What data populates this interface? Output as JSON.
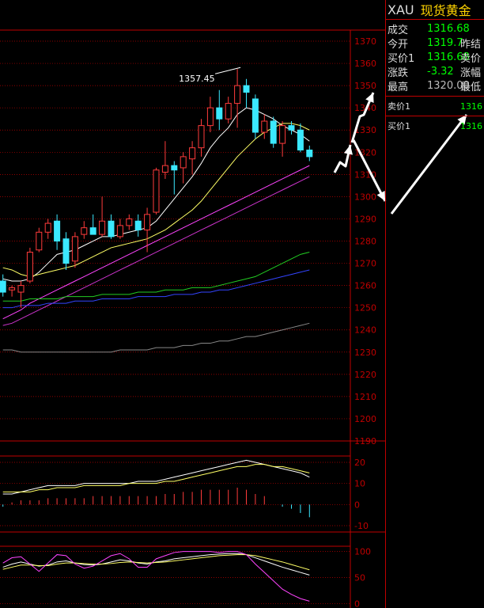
{
  "quote": {
    "symbol": "XAU",
    "name": "现货黄金",
    "rows": [
      {
        "label": "成交",
        "value": "1316.68",
        "color": "#00ff00",
        "label2": ""
      },
      {
        "label": "今开",
        "value": "1319.7",
        "color": "#00ff00",
        "label2": "昨结"
      },
      {
        "label": "买价1",
        "value": "1316.68",
        "color": "#00ff00",
        "label2": "卖价"
      },
      {
        "label": "涨跌",
        "value": "-3.32",
        "color": "#00ff00",
        "label2": "涨幅"
      },
      {
        "label": "最高",
        "value": "1320.00",
        "color": "#bbbbbb",
        "label2": "最低"
      }
    ],
    "sell1": {
      "label": "卖价1",
      "value": "1316"
    },
    "buy1": {
      "label": "买价1",
      "value": "1316"
    }
  },
  "chart_data": [
    {
      "type": "candlestick",
      "title": "",
      "ylim": [
        1190,
        1375
      ],
      "yticks": [
        "1370",
        "1360",
        "1350",
        "1340",
        "1330",
        "1320",
        "1310",
        "1300",
        "1290",
        "1280",
        "1270",
        "1260",
        "1250",
        "1240",
        "1230",
        "1220",
        "1210",
        "1200",
        "1190"
      ],
      "annotation": {
        "text": "1357.45",
        "value": 1357.45
      },
      "candles": [
        {
          "o": 1262,
          "h": 1265,
          "l": 1255,
          "c": 1257
        },
        {
          "o": 1258,
          "h": 1260,
          "l": 1255,
          "c": 1259
        },
        {
          "o": 1257,
          "h": 1262,
          "l": 1250,
          "c": 1260
        },
        {
          "o": 1262,
          "h": 1277,
          "l": 1261,
          "c": 1275
        },
        {
          "o": 1276,
          "h": 1286,
          "l": 1275,
          "c": 1284
        },
        {
          "o": 1284,
          "h": 1290,
          "l": 1281,
          "c": 1288
        },
        {
          "o": 1289,
          "h": 1292,
          "l": 1276,
          "c": 1280
        },
        {
          "o": 1281,
          "h": 1284,
          "l": 1267,
          "c": 1270
        },
        {
          "o": 1271,
          "h": 1284,
          "l": 1268,
          "c": 1282
        },
        {
          "o": 1283,
          "h": 1289,
          "l": 1281,
          "c": 1286
        },
        {
          "o": 1286,
          "h": 1292,
          "l": 1283,
          "c": 1283
        },
        {
          "o": 1283,
          "h": 1300,
          "l": 1282,
          "c": 1289
        },
        {
          "o": 1289,
          "h": 1292,
          "l": 1281,
          "c": 1282
        },
        {
          "o": 1282,
          "h": 1290,
          "l": 1281,
          "c": 1287
        },
        {
          "o": 1287,
          "h": 1292,
          "l": 1285,
          "c": 1290
        },
        {
          "o": 1289,
          "h": 1292,
          "l": 1282,
          "c": 1285
        },
        {
          "o": 1285,
          "h": 1295,
          "l": 1275,
          "c": 1292
        },
        {
          "o": 1293,
          "h": 1313,
          "l": 1292,
          "c": 1312
        },
        {
          "o": 1311,
          "h": 1325,
          "l": 1308,
          "c": 1314
        },
        {
          "o": 1314,
          "h": 1316,
          "l": 1301,
          "c": 1312
        },
        {
          "o": 1313,
          "h": 1320,
          "l": 1306,
          "c": 1318
        },
        {
          "o": 1317,
          "h": 1325,
          "l": 1310,
          "c": 1322
        },
        {
          "o": 1322,
          "h": 1335,
          "l": 1318,
          "c": 1332
        },
        {
          "o": 1332,
          "h": 1345,
          "l": 1329,
          "c": 1340
        },
        {
          "o": 1340,
          "h": 1348,
          "l": 1330,
          "c": 1335
        },
        {
          "o": 1335,
          "h": 1345,
          "l": 1333,
          "c": 1342
        },
        {
          "o": 1342,
          "h": 1357.45,
          "l": 1331,
          "c": 1350
        },
        {
          "o": 1350,
          "h": 1353,
          "l": 1340,
          "c": 1347
        },
        {
          "o": 1344,
          "h": 1346,
          "l": 1326,
          "c": 1329
        },
        {
          "o": 1329,
          "h": 1337,
          "l": 1326,
          "c": 1334
        },
        {
          "o": 1334,
          "h": 1336,
          "l": 1322,
          "c": 1324
        },
        {
          "o": 1324,
          "h": 1334,
          "l": 1318,
          "c": 1332
        },
        {
          "o": 1332,
          "h": 1334,
          "l": 1328,
          "c": 1330
        },
        {
          "o": 1330,
          "h": 1333,
          "l": 1320,
          "c": 1321
        },
        {
          "o": 1321,
          "h": 1323,
          "l": 1316,
          "c": 1318
        }
      ],
      "ma_lines": [
        {
          "color": "#ffffff",
          "values": [
            1263,
            1262,
            1262,
            1263,
            1266,
            1270,
            1274,
            1275,
            1276,
            1278,
            1280,
            1282,
            1282,
            1283,
            1284,
            1285,
            1286,
            1289,
            1294,
            1299,
            1304,
            1309,
            1315,
            1322,
            1327,
            1331,
            1337,
            1340,
            1339,
            1337,
            1335,
            1332,
            1330,
            1328,
            1325
          ]
        },
        {
          "color": "#ffff66",
          "values": [
            1268,
            1267,
            1265,
            1264,
            1265,
            1266,
            1267,
            1268,
            1269,
            1271,
            1273,
            1275,
            1277,
            1278,
            1279,
            1280,
            1281,
            1283,
            1285,
            1288,
            1291,
            1294,
            1298,
            1303,
            1308,
            1313,
            1318,
            1322,
            1326,
            1329,
            1331,
            1333,
            1333,
            1332,
            1330
          ]
        },
        {
          "color": "#ff44ff",
          "values": [
            1245,
            1247,
            1249,
            1252,
            1254,
            1256,
            1258,
            1260,
            1262,
            1264,
            1266,
            1268,
            1270,
            1272,
            1274,
            1276,
            1278,
            1280,
            1282,
            1284,
            1286,
            1288,
            1290,
            1292,
            1294,
            1296,
            1298,
            1300,
            1302,
            1304,
            1306,
            1308,
            1310,
            1312,
            1314
          ]
        },
        {
          "color": "#cc33cc",
          "values": [
            1242,
            1243,
            1245,
            1247,
            1249,
            1251,
            1253,
            1255,
            1257,
            1259,
            1261,
            1263,
            1265,
            1267,
            1269,
            1271,
            1273,
            1275,
            1277,
            1279,
            1281,
            1283,
            1285,
            1287,
            1289,
            1291,
            1293,
            1295,
            1297,
            1299,
            1301,
            1303,
            1305,
            1307,
            1309
          ]
        },
        {
          "color": "#22cc22",
          "values": [
            1253,
            1253,
            1253,
            1254,
            1254,
            1254,
            1254,
            1255,
            1255,
            1255,
            1255,
            1256,
            1256,
            1256,
            1256,
            1257,
            1257,
            1257,
            1258,
            1258,
            1258,
            1259,
            1259,
            1259,
            1260,
            1261,
            1262,
            1263,
            1264,
            1266,
            1268,
            1270,
            1272,
            1274,
            1275
          ]
        },
        {
          "color": "#3344ff",
          "values": [
            1250,
            1250,
            1251,
            1251,
            1251,
            1252,
            1252,
            1252,
            1253,
            1253,
            1253,
            1254,
            1254,
            1254,
            1254,
            1255,
            1255,
            1255,
            1255,
            1256,
            1256,
            1256,
            1257,
            1257,
            1258,
            1258,
            1259,
            1260,
            1261,
            1262,
            1263,
            1264,
            1265,
            1266,
            1267
          ]
        },
        {
          "color": "#888888",
          "values": [
            1231,
            1231,
            1230,
            1230,
            1230,
            1230,
            1230,
            1230,
            1230,
            1230,
            1230,
            1230,
            1230,
            1231,
            1231,
            1231,
            1231,
            1232,
            1232,
            1232,
            1233,
            1233,
            1234,
            1234,
            1235,
            1235,
            1236,
            1237,
            1237,
            1238,
            1239,
            1240,
            1241,
            1242,
            1243
          ]
        }
      ]
    },
    {
      "type": "line",
      "title": "",
      "ylim": [
        -13,
        23
      ],
      "yticks": [
        "20",
        "10",
        "0",
        "-10"
      ],
      "series": [
        {
          "color": "#ffffff",
          "values": [
            5,
            5,
            6,
            7,
            8,
            9,
            9,
            9,
            9,
            10,
            10,
            10,
            10,
            10,
            10,
            11,
            11,
            11,
            12,
            13,
            14,
            15,
            16,
            17,
            18,
            19,
            20,
            21,
            20,
            19,
            18,
            17,
            16,
            15,
            13
          ]
        },
        {
          "color": "#ffff66",
          "values": [
            6,
            6,
            6,
            6,
            7,
            7,
            8,
            8,
            8,
            9,
            9,
            9,
            9,
            9,
            10,
            10,
            10,
            10,
            11,
            11,
            12,
            13,
            14,
            15,
            16,
            17,
            18,
            18,
            19,
            19,
            18,
            18,
            17,
            16,
            15
          ]
        }
      ],
      "bars": [
        -1,
        1,
        2,
        2,
        2,
        3,
        3,
        3,
        3,
        3,
        4,
        4,
        4,
        4,
        4,
        4,
        4,
        4,
        5,
        5,
        6,
        6,
        7,
        7,
        7,
        7,
        8,
        7,
        5,
        4,
        0,
        -1,
        -2,
        -4,
        -6
      ]
    },
    {
      "type": "line",
      "title": "",
      "ylim": [
        -8,
        110
      ],
      "yticks": [
        "100",
        "50",
        "0"
      ],
      "series": [
        {
          "color": "#ffffff",
          "values": [
            70,
            76,
            80,
            76,
            72,
            74,
            80,
            82,
            78,
            75,
            74,
            76,
            80,
            84,
            82,
            78,
            76,
            80,
            82,
            86,
            88,
            90,
            92,
            94,
            95,
            96,
            96,
            94,
            88,
            82,
            76,
            70,
            65,
            60,
            55
          ]
        },
        {
          "color": "#ffff66",
          "values": [
            66,
            70,
            74,
            74,
            73,
            73,
            76,
            78,
            78,
            77,
            76,
            76,
            77,
            79,
            80,
            79,
            78,
            79,
            80,
            82,
            84,
            86,
            88,
            90,
            92,
            93,
            94,
            94,
            92,
            88,
            84,
            80,
            75,
            70,
            65
          ]
        },
        {
          "color": "#ff44ff",
          "values": [
            78,
            88,
            90,
            76,
            62,
            78,
            94,
            92,
            76,
            68,
            72,
            82,
            92,
            96,
            86,
            70,
            70,
            86,
            92,
            98,
            100,
            100,
            100,
            100,
            98,
            100,
            100,
            94,
            76,
            60,
            44,
            28,
            18,
            10,
            5
          ]
        }
      ]
    }
  ]
}
